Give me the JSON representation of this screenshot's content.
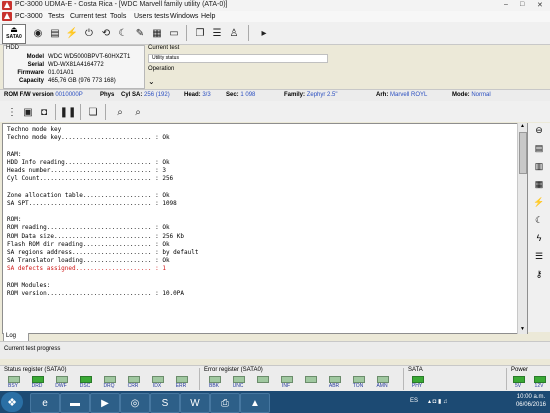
{
  "window": {
    "title": "PC-3000 UDMA-E - Costa Rica - [WDC Marvell family utility (ATA-0)]",
    "controls": [
      "–",
      "□",
      "✕"
    ]
  },
  "menu": [
    "PC-3000",
    "Tests",
    "Current test",
    "Tools",
    "Users tests",
    "Windows",
    "Help"
  ],
  "toolbar": {
    "sata_label": "SATA0"
  },
  "hdd": {
    "caption": "HDD",
    "model_k": "Model",
    "model": "WDC WD5000BPVT-60HXZT1",
    "serial_k": "Serial",
    "serial": "WD-WX81A4164772",
    "firmware_k": "Firmware",
    "firmware": "01.01A01",
    "capacity_k": "Capacity",
    "capacity": "465,76 GB (976 773 168)"
  },
  "current_test": {
    "label": "Current test",
    "value": "Utility status",
    "op_label": "Operation"
  },
  "infobar": {
    "rom_k": "ROM F/W version",
    "rom": "0010000P",
    "phys_k": "Phys",
    "cyl_k": "Cyl SA:",
    "cyl": "256 (192)",
    "head_k": "Head:",
    "head": "3/3",
    "sec_k": "Sec:",
    "sec": "1 098",
    "fam_k": "Family:",
    "fam": "Zephyr 2.5\"",
    "arh_k": "Arh:",
    "arh": "Marvell ROYL",
    "mode_k": "Mode:",
    "mode": "Normal"
  },
  "log": {
    "lines": [
      "Techno mode key",
      "Techno mode key......................... : Ok",
      "",
      "RAM:",
      "HDD Info reading........................ : Ok",
      "Heads number............................ : 3",
      "Cyl Count............................... : 256",
      "",
      "Zone allocation table................... : Ok",
      "SA SPT.................................. : 1098",
      "",
      "ROM:",
      "ROM reading............................. : Ok",
      "ROM Data size........................... : 256 Kb",
      "Flash ROM dir reading................... : Ok",
      "SA regions address...................... : by default",
      "SA Translator loading................... : Ok",
      "SA defects assigned..................... : 1",
      "",
      "ROM Modules:",
      "ROM version............................. : 10.0PA"
    ],
    "red_line_index": 17,
    "tab_label": "Log"
  },
  "current_test_progress": "Current test progress",
  "status": {
    "sr_label": "Status register (SATA0)",
    "sr_flags": [
      "BSY",
      "DRD",
      "DWF",
      "DSC",
      "DRQ",
      "CRR",
      "IDX",
      "ERR"
    ],
    "er_label": "Error register (SATA0)",
    "er_flags": [
      "BBK",
      "UNC",
      "",
      "INF",
      "",
      "ABR",
      "TON",
      "AMN"
    ],
    "sata_label": "SATA",
    "sata_flag": "PHY",
    "power_label": "Power",
    "power_flags": [
      "5V",
      "12V"
    ]
  },
  "taskbar": {
    "lang": "ES",
    "time": "10:00 a.m.",
    "date": "06/06/2016"
  },
  "colors": {
    "led_on": "#3aa935",
    "log_red": "#d01818",
    "taskbar": "#1c4a73"
  }
}
